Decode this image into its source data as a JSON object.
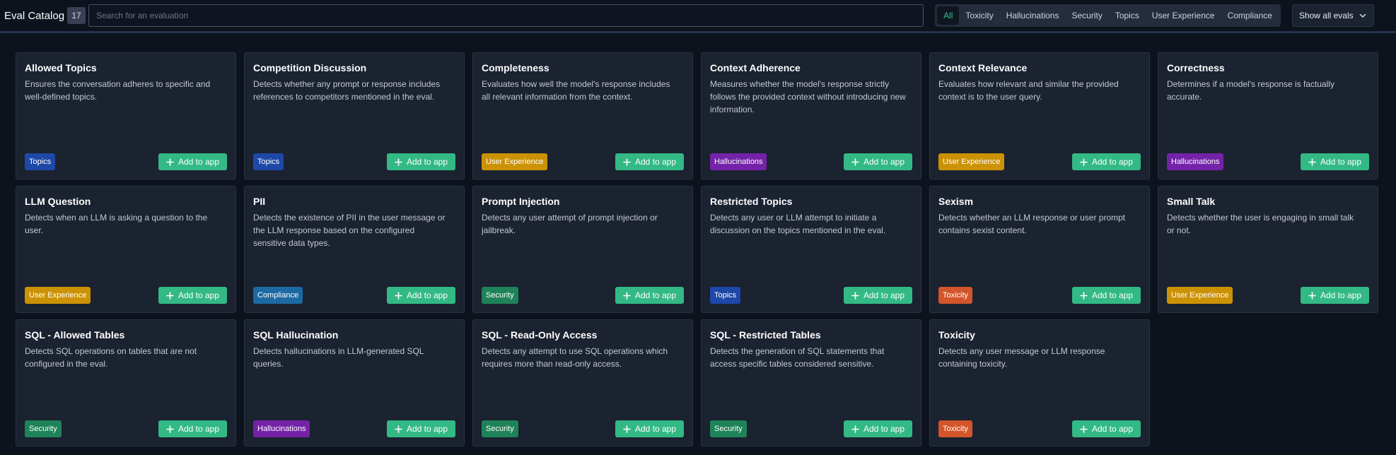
{
  "header": {
    "title": "Eval Catalog",
    "count": "17",
    "search_placeholder": "Search for an evaluation",
    "filters": [
      "All",
      "Toxicity",
      "Hallucinations",
      "Security",
      "Topics",
      "User Experience",
      "Compliance"
    ],
    "active_filter": "All",
    "show_all": "Show all evals"
  },
  "add_label": "Add to app",
  "tag_colors": {
    "Topics": "#1e48a8",
    "User Experience": "#cc9205",
    "Hallucinations": "#7423a8",
    "Compliance": "#1c69a4",
    "Security": "#1f8359",
    "Toxicity": "#d2552b"
  },
  "cards": [
    {
      "title": "Allowed Topics",
      "desc": "Ensures the conversation adheres to specific and well-defined topics.",
      "tag": "Topics"
    },
    {
      "title": "Competition Discussion",
      "desc": "Detects whether any prompt or response includes references to competitors mentioned in the eval.",
      "tag": "Topics"
    },
    {
      "title": "Completeness",
      "desc": "Evaluates how well the model's response includes all relevant information from the context.",
      "tag": "User Experience"
    },
    {
      "title": "Context Adherence",
      "desc": "Measures whether the model's response strictly follows the provided context without introducing new information.",
      "tag": "Hallucinations"
    },
    {
      "title": "Context Relevance",
      "desc": "Evaluates how relevant and similar the provided context is to the user query.",
      "tag": "User Experience"
    },
    {
      "title": "Correctness",
      "desc": "Determines if a model's response is factually accurate.",
      "tag": "Hallucinations"
    },
    {
      "title": "LLM Question",
      "desc": "Detects when an LLM is asking a question to the user.",
      "tag": "User Experience"
    },
    {
      "title": "PII",
      "desc": "Detects the existence of PII in the user message or the LLM response based on the configured sensitive data types.",
      "tag": "Compliance"
    },
    {
      "title": "Prompt Injection",
      "desc": "Detects any user attempt of prompt injection or jailbreak.",
      "tag": "Security"
    },
    {
      "title": "Restricted Topics",
      "desc": "Detects any user or LLM attempt to initiate a discussion on the topics mentioned in the eval.",
      "tag": "Topics"
    },
    {
      "title": "Sexism",
      "desc": "Detects whether an LLM response or user prompt contains sexist content.",
      "tag": "Toxicity"
    },
    {
      "title": "Small Talk",
      "desc": "Detects whether the user is engaging in small talk or not.",
      "tag": "User Experience"
    },
    {
      "title": "SQL - Allowed Tables",
      "desc": "Detects SQL operations on tables that are not configured in the eval.",
      "tag": "Security"
    },
    {
      "title": "SQL Hallucination",
      "desc": "Detects hallucinations in LLM-generated SQL queries.",
      "tag": "Hallucinations"
    },
    {
      "title": "SQL - Read-Only Access",
      "desc": "Detects any attempt to use SQL operations which requires more than read-only access.",
      "tag": "Security"
    },
    {
      "title": "SQL - Restricted Tables",
      "desc": "Detects the generation of SQL statements that access specific tables considered sensitive.",
      "tag": "Security"
    },
    {
      "title": "Toxicity",
      "desc": "Detects any user message or LLM response containing toxicity.",
      "tag": "Toxicity"
    }
  ]
}
